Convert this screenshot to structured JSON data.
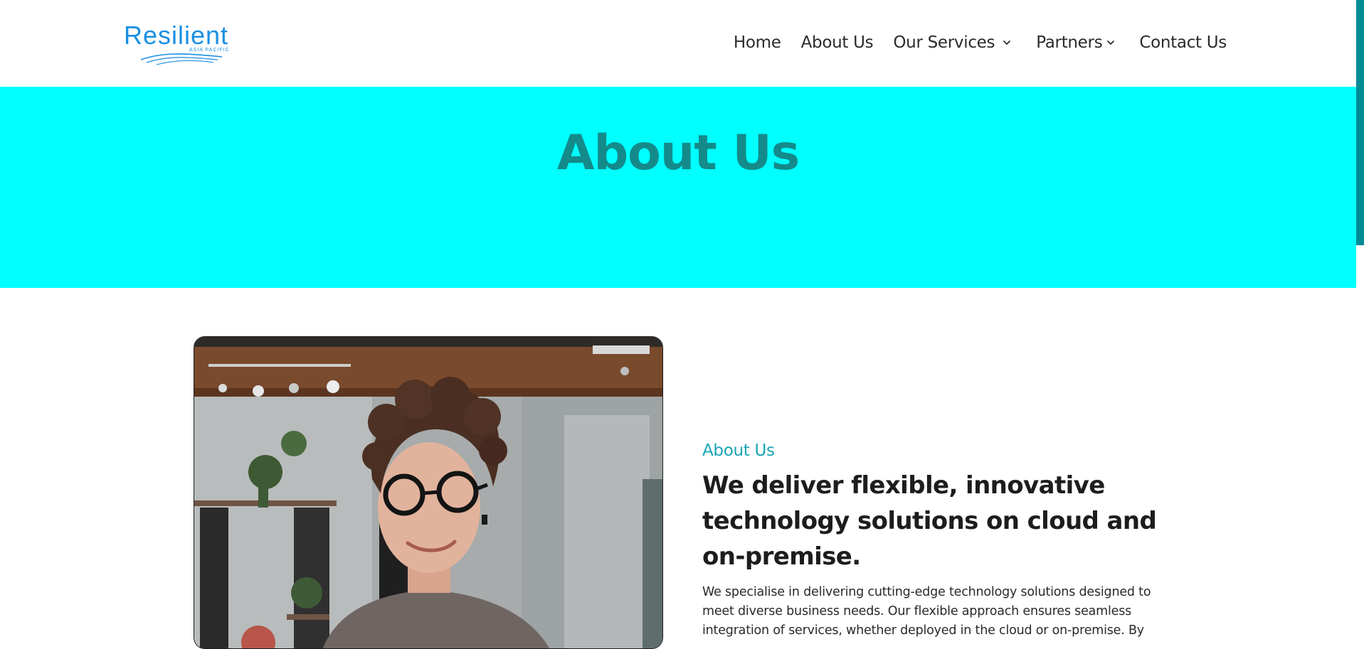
{
  "header": {
    "logo": {
      "word": "Resilient",
      "subtitle": "ASIA PACIFIC"
    },
    "nav": [
      {
        "label": "Home",
        "has_dropdown": false
      },
      {
        "label": "About Us",
        "has_dropdown": false
      },
      {
        "label": "Our Services",
        "has_dropdown": true
      },
      {
        "label": "Partners",
        "has_dropdown": true
      },
      {
        "label": "Contact Us",
        "has_dropdown": false
      }
    ]
  },
  "hero": {
    "title": "About Us",
    "background": "#00ffff",
    "title_color": "#148a8a"
  },
  "about": {
    "eyebrow": "About Us",
    "headline": "We deliver flexible, innovative technology solutions on cloud and on-premise.",
    "body": "We specialise in delivering cutting-edge technology solutions designed to meet diverse business needs. Our flexible approach ensures seamless integration of services, whether deployed in the cloud or on-premise. By",
    "image_icon": "portrait-photo"
  },
  "colors": {
    "accent": "#19a5b4",
    "logo_blue": "#1a8fe3",
    "scroll_thumb": "#008b95",
    "text_dark": "#1d1d1d"
  }
}
